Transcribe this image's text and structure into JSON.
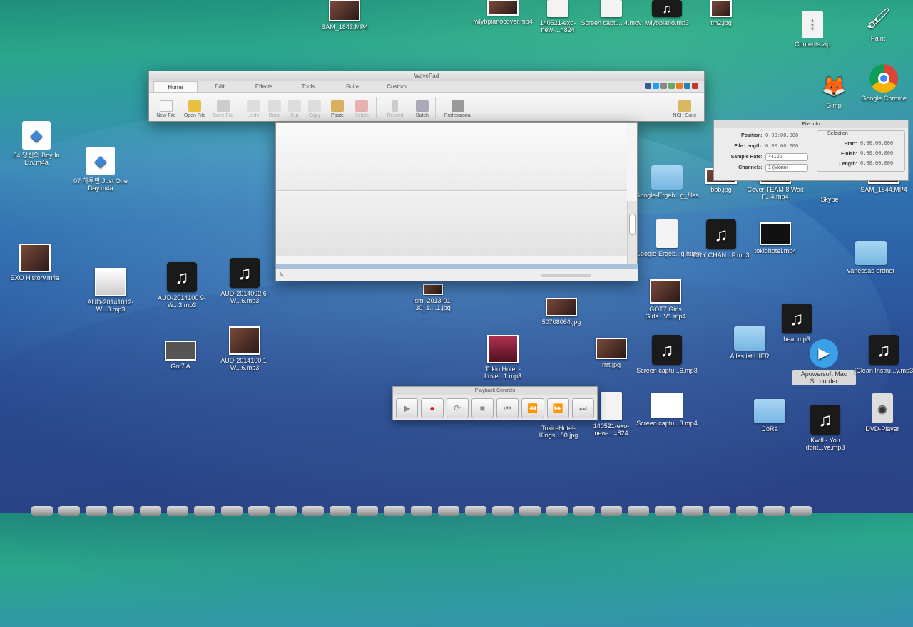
{
  "desktop_icons": [
    {
      "label": "SAM_1843.MP4",
      "kind": "photo"
    },
    {
      "label": "lwlybpianocover.mp4",
      "kind": "photo"
    },
    {
      "label": "140521-exo-new-...=824",
      "kind": "doc"
    },
    {
      "label": "Screen captu...4.mov",
      "kind": "doc"
    },
    {
      "label": "lwlybpiano.mp3",
      "kind": "music"
    },
    {
      "label": "tm2.jpg",
      "kind": "photo"
    },
    {
      "label": "Contents.zip",
      "kind": "zip"
    },
    {
      "label": "Paint",
      "kind": "app"
    },
    {
      "label": "Gimp",
      "kind": "app"
    },
    {
      "label": "Google Chrome",
      "kind": "app"
    },
    {
      "label": "04 당신의 Boy In Luv.m4a",
      "kind": "m4a"
    },
    {
      "label": "07 하루만 Just One Day.m4a",
      "kind": "m4a"
    },
    {
      "label": "EXO History.m4a",
      "kind": "photo"
    },
    {
      "label": "AUD-20141012-W...8.mp3",
      "kind": "photo"
    },
    {
      "label": "AUD-2014100 9-W...3.mp3",
      "kind": "music"
    },
    {
      "label": "AUD-2014092 6-W...6.mp3",
      "kind": "music"
    },
    {
      "label": "AUD-2014100 1-W...6.mp3",
      "kind": "photo"
    },
    {
      "label": "Got7 A",
      "kind": "photo"
    },
    {
      "label": "Google-Ergeb...g_files",
      "kind": "folder"
    },
    {
      "label": "bbb.jpg",
      "kind": "photo"
    },
    {
      "label": "Cover TEAM 8 Wait F...4.mp4",
      "kind": "photo"
    },
    {
      "label": "Skype",
      "kind": "app"
    },
    {
      "label": "SAM_1844.MP4",
      "kind": "photo"
    },
    {
      "label": "Google-Ergeb...g.html",
      "kind": "doc"
    },
    {
      "label": "CRY CHAN...P.mp3",
      "kind": "music"
    },
    {
      "label": "tokiohotel.mp4",
      "kind": "photo"
    },
    {
      "label": "vanessas ordner",
      "kind": "folder"
    },
    {
      "label": "ism_2013-01-30_1....1.jpg",
      "kind": "photo"
    },
    {
      "label": "50708064.jpg",
      "kind": "photo"
    },
    {
      "label": "GOT7 Girls Girls...V1.mp4",
      "kind": "photo"
    },
    {
      "label": "beat.mp3",
      "kind": "music"
    },
    {
      "label": "Alles ist HIER",
      "kind": "folder"
    },
    {
      "label": "Tokio Hotel - Love...1.mp3",
      "kind": "photo"
    },
    {
      "label": "rrrt.jpg",
      "kind": "photo"
    },
    {
      "label": "Screen captu...6.mp3",
      "kind": "music"
    },
    {
      "label": "Apowersoft Mac S...corder",
      "kind": "app"
    },
    {
      "label": "[Clean Instru...y.mp3",
      "kind": "music"
    },
    {
      "label": "Tokio-Hotel-Kings...80.jpg",
      "kind": "photo"
    },
    {
      "label": "140521-exo-new-...=824",
      "kind": "doc"
    },
    {
      "label": "Screen captu...3.mp4",
      "kind": "photo"
    },
    {
      "label": "CoRa",
      "kind": "folder"
    },
    {
      "label": "Kwill - You dont...ve.mp3",
      "kind": "music"
    },
    {
      "label": "DVD-Player",
      "kind": "app"
    }
  ],
  "wavepad": {
    "title": "WavePad",
    "tabs": [
      "Home",
      "Edit",
      "Effects",
      "Tools",
      "Suite",
      "Custom"
    ],
    "toolbar": [
      "New File",
      "Open File",
      "Save File",
      "Undo",
      "Redo",
      "Cut",
      "Copy",
      "Paste",
      "Delete",
      "Record",
      "Batch",
      "Professional",
      "NCH Suite"
    ]
  },
  "file_info": {
    "title": "File Info",
    "position_label": "Position:",
    "position": "0:00:00.000",
    "length_label": "File Length:",
    "length": "0:00:00.000",
    "rate_label": "Sample Rate:",
    "rate": "44100",
    "channels_label": "Channels:",
    "channels": "1 (Mono)",
    "selection_title": "Selection",
    "start_label": "Start:",
    "start": "0:00:00.000",
    "finish_label": "Finish:",
    "finish": "0:00:00.000",
    "slength_label": "Length:",
    "slength": "0:00:00.000"
  },
  "playback": {
    "title": "Playback Controls",
    "buttons": [
      "play",
      "record",
      "loop",
      "stop",
      "skip-start",
      "rewind",
      "fast-forward",
      "skip-end"
    ]
  }
}
